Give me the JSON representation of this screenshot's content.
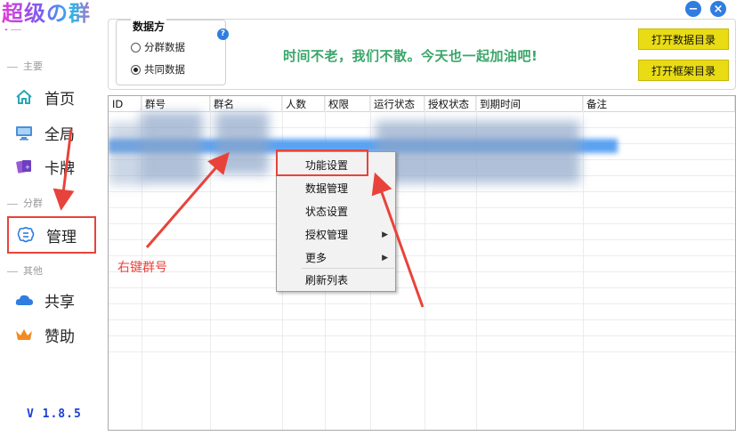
{
  "app": {
    "title": "超级の群娱",
    "version": "V 1.8.5",
    "window_buttons": {
      "minimize": "−",
      "close": "×"
    }
  },
  "sidebar": {
    "sections": [
      {
        "label": "主要"
      },
      {
        "label": "分群"
      },
      {
        "label": "其他"
      }
    ],
    "items": [
      {
        "label": "首页",
        "icon": "home-icon"
      },
      {
        "label": "全局",
        "icon": "monitor-icon"
      },
      {
        "label": "卡牌",
        "icon": "card-icon"
      },
      {
        "label": "管理",
        "icon": "manage-icon",
        "active": true
      },
      {
        "label": "共享",
        "icon": "cloud-icon"
      },
      {
        "label": "赞助",
        "icon": "crown-icon"
      }
    ]
  },
  "data_source": {
    "title": "数据方",
    "help": "?",
    "options": [
      {
        "label": "分群数据",
        "checked": false
      },
      {
        "label": "共同数据",
        "checked": true
      }
    ]
  },
  "slogan": "时间不老，我们不散。今天也一起加油吧!",
  "buttons": {
    "open_data_dir": "打开数据目录",
    "open_frame_dir": "打开框架目录"
  },
  "table": {
    "columns": [
      "ID",
      "群号",
      "群名",
      "人数",
      "权限",
      "运行状态",
      "授权状态",
      "到期时间",
      "备注"
    ]
  },
  "context_menu": {
    "items": [
      {
        "label": "功能设置",
        "submenu": false
      },
      {
        "label": "数据管理",
        "submenu": true
      },
      {
        "label": "状态设置",
        "submenu": false
      },
      {
        "label": "授权管理",
        "submenu": true
      },
      {
        "label": "更多",
        "submenu": true
      },
      {
        "label": "刷新列表",
        "submenu": false
      }
    ],
    "submenu_arrow": "▶"
  },
  "annotation": {
    "text": "右键群号",
    "color": "#e8433b"
  },
  "colors": {
    "accent_blue": "#2f7de1",
    "slogan_green": "#3aa66a",
    "button_yellow": "#e9dc14",
    "annotation_red": "#e8433b",
    "version_blue": "#1a3fd6"
  }
}
